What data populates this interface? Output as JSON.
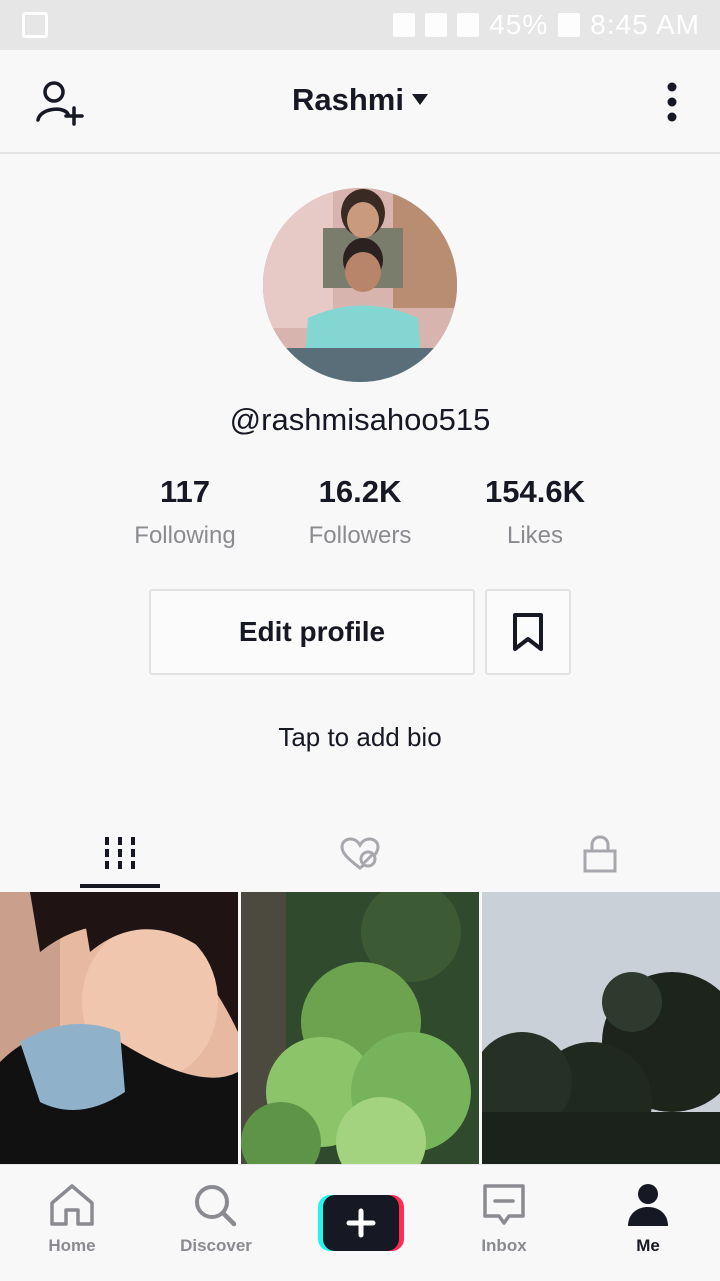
{
  "status_bar": {
    "battery": "45%",
    "time": "8:45 AM"
  },
  "header": {
    "title": "Rashmi"
  },
  "profile": {
    "handle": "@rashmisahoo515",
    "stats": [
      {
        "value": "117",
        "label": "Following"
      },
      {
        "value": "16.2K",
        "label": "Followers"
      },
      {
        "value": "154.6K",
        "label": "Likes"
      }
    ],
    "edit_label": "Edit profile",
    "bio_placeholder": "Tap to add bio"
  },
  "tabs": [
    {
      "icon": "videos-grid-icon",
      "active": true
    },
    {
      "icon": "liked-videos-icon",
      "active": false
    },
    {
      "icon": "lock-icon",
      "active": false
    }
  ],
  "nav": {
    "home": "Home",
    "discover": "Discover",
    "inbox": "Inbox",
    "me": "Me"
  },
  "colors": {
    "create_left": "#25F4EE",
    "create_right": "#FE2C55",
    "text": "#161823",
    "muted": "#8a8b91"
  }
}
